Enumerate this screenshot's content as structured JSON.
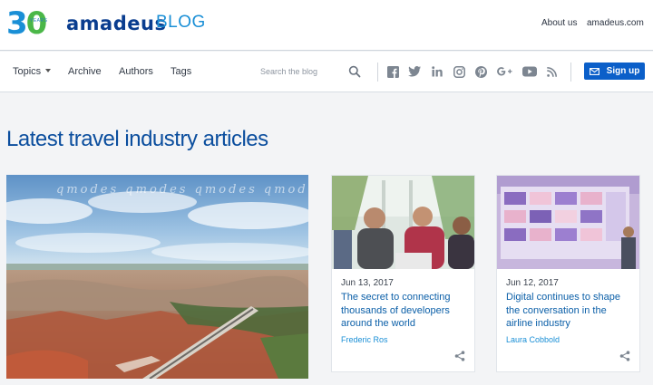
{
  "brand": {
    "anniversary_number": "30",
    "anniversary_word": "YEARS",
    "name": "amadeus",
    "section": "BLOG",
    "color_primary": "#0a3d8f",
    "color_accent": "#1a8fd6",
    "color_green": "#4bb748"
  },
  "top_links": [
    {
      "label": "About us"
    },
    {
      "label": "amadeus.com"
    }
  ],
  "nav": {
    "items": [
      {
        "label": "Topics",
        "has_dropdown": true
      },
      {
        "label": "Archive"
      },
      {
        "label": "Authors"
      },
      {
        "label": "Tags"
      }
    ],
    "search_placeholder": "Search the blog",
    "social_icons": [
      "facebook-icon",
      "twitter-icon",
      "linkedin-icon",
      "instagram-icon",
      "pinterest-icon",
      "google-plus-icon",
      "youtube-icon",
      "rss-icon"
    ],
    "signup_label": "Sign up",
    "signup_color": "#0b5fc9"
  },
  "main": {
    "title": "Latest travel industry articles",
    "hero_watermark": "qmodes qmodes qmodes qmodes",
    "articles": [
      {
        "date": "Jun 13, 2017",
        "title": "The secret to connecting thousands of developers around the world",
        "author": "Frederic Ros"
      },
      {
        "date": "Jun 12, 2017",
        "title": "Digital continues to shape the conversation in the airline industry",
        "author": "Laura Cobbold"
      }
    ]
  }
}
